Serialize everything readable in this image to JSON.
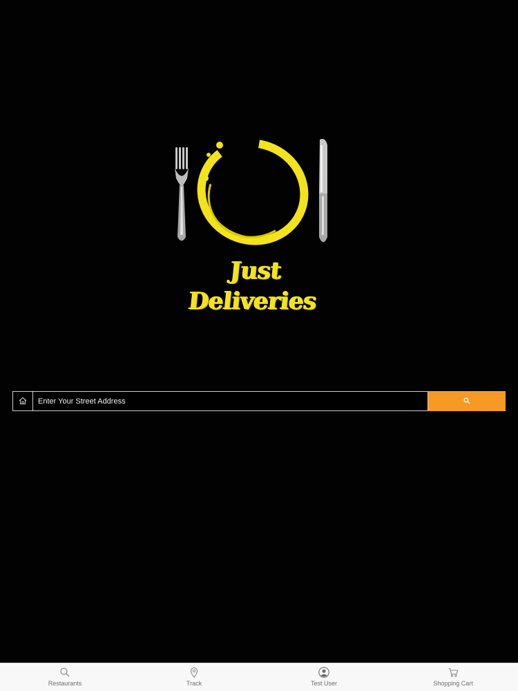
{
  "brand": {
    "name": "Just Deliveries",
    "accent_color": "#f69a24",
    "logo_color": "#f3e31d"
  },
  "search": {
    "placeholder": "Enter Your Street Address",
    "value": "",
    "leading_icon": "home-icon",
    "button_icon": "search-icon"
  },
  "tab_bar": {
    "items": [
      {
        "label": "Restaurants",
        "icon": "search-icon"
      },
      {
        "label": "Track",
        "icon": "map-pin-icon"
      },
      {
        "label": "Test User",
        "icon": "user-avatar-icon"
      },
      {
        "label": "Shopping Cart",
        "icon": "cart-icon"
      }
    ]
  }
}
